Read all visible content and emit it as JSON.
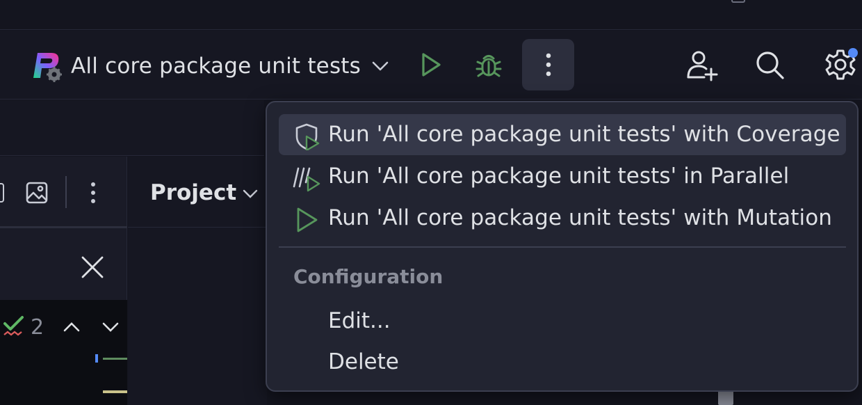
{
  "toolbar": {
    "run_config_label": "All core package unit tests"
  },
  "side": {
    "project_label": "Project",
    "problems_count": "2"
  },
  "menu": {
    "items": [
      {
        "label": "Run 'All core package unit tests' with Coverage",
        "icon": "coverage-icon"
      },
      {
        "label": "Run 'All core package unit tests' in Parallel",
        "icon": "parallel-run-icon"
      },
      {
        "label": "Run 'All core package unit tests' with Mutation",
        "icon": "run-icon"
      }
    ],
    "section_label": "Configuration",
    "edit_label": "Edit...",
    "delete_label": "Delete"
  },
  "colors": {
    "accent_blue": "#548af7",
    "run_green": "#57965c",
    "background": "#14151f",
    "menu_bg": "#222431"
  }
}
